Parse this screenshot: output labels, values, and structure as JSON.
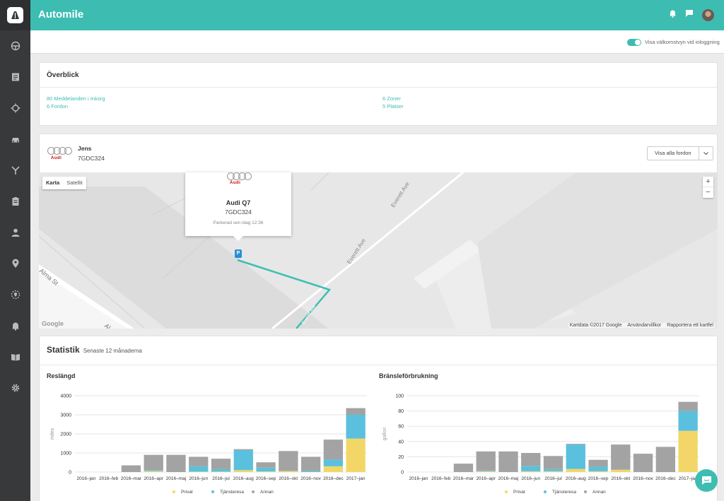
{
  "app": {
    "title": "Automile"
  },
  "sidebar": {
    "items": [
      {
        "name": "dashboard-icon"
      },
      {
        "name": "journal-icon"
      },
      {
        "name": "location-icon"
      },
      {
        "name": "car-icon"
      },
      {
        "name": "trips-icon"
      },
      {
        "name": "reports-icon"
      },
      {
        "name": "user-icon"
      },
      {
        "name": "places-icon"
      },
      {
        "name": "zones-icon"
      },
      {
        "name": "alerts-icon"
      },
      {
        "name": "book-icon"
      },
      {
        "name": "settings-icon"
      }
    ]
  },
  "subheader": {
    "toggle_label": "Visa välkomstvyn vid inloggning",
    "toggle_on": true
  },
  "overview": {
    "title": "Överblick",
    "links": {
      "inbox": "80 Meddelanden i Inkorg",
      "vehicles": "6 Fordon",
      "zones": "6 Zoner",
      "places": "5 Platser"
    }
  },
  "vehicle": {
    "driver": "Jens",
    "plate": "7GDC324",
    "brand_text": "Audi",
    "show_all_button": "Visa alla fordon"
  },
  "map": {
    "type_map": "Karta",
    "type_satellite": "Satellit",
    "zoom_in": "+",
    "zoom_out": "−",
    "attribution": "Kartdata ©2017 Google",
    "terms": "Användarvillkor",
    "report": "Rapportera ett kartfel",
    "google": "Google",
    "street_everett_1": "Everett Ave",
    "street_everett_2": "Everett Ave",
    "street_alma": "Alma St",
    "street_al": "Al",
    "street_small": "Everett Ave",
    "popup": {
      "brand_text": "Audi",
      "model": "Audi Q7",
      "plate": "7GDC324",
      "status": "Parkerad sen idag 12:36"
    },
    "pin_label": "P"
  },
  "stats": {
    "title": "Statistik",
    "subtitle": "Senaste 12 månaderna"
  },
  "colors": {
    "accent": "#3dbdb2",
    "privat": "#f2d768",
    "tjanst": "#5bc0de",
    "annan": "#a3a3a3"
  },
  "chart_data": [
    {
      "type": "bar",
      "stacked": true,
      "title": "Reslängd",
      "ylabel": "miles",
      "ylim": [
        0,
        4000
      ],
      "yticks": [
        0,
        1000,
        2000,
        3000,
        4000
      ],
      "categories": [
        "2016–jan",
        "2016–feb",
        "2016–mar",
        "2016–apr",
        "2016–maj",
        "2016–jun",
        "2016–jul",
        "2016–aug",
        "2016–sep",
        "2016–okt",
        "2016–nov",
        "2016–dec",
        "2017–jan"
      ],
      "series": [
        {
          "name": "Privat",
          "values": [
            0,
            0,
            0,
            50,
            0,
            20,
            20,
            100,
            30,
            50,
            0,
            300,
            1750
          ]
        },
        {
          "name": "Tjänsteresa",
          "values": [
            0,
            0,
            0,
            50,
            0,
            280,
            130,
            1050,
            200,
            0,
            50,
            350,
            1250
          ]
        },
        {
          "name": "Annan",
          "values": [
            0,
            0,
            350,
            800,
            900,
            500,
            550,
            50,
            280,
            1050,
            750,
            1050,
            350
          ]
        }
      ],
      "legend_position": "bottom"
    },
    {
      "type": "bar",
      "stacked": true,
      "title": "Bränsleförbrukning",
      "ylabel": "gallon",
      "ylim": [
        0,
        100
      ],
      "yticks": [
        0,
        20,
        40,
        60,
        80,
        100
      ],
      "categories": [
        "2016–jan",
        "2016–feb",
        "2016–mar",
        "2016–apr",
        "2016–maj",
        "2016–jun",
        "2016–jul",
        "2016–aug",
        "2016–sep",
        "2016–okt",
        "2016–nov",
        "2016–dec",
        "2017–jan"
      ],
      "series": [
        {
          "name": "Privat",
          "values": [
            0,
            0,
            0,
            1,
            0,
            1,
            1,
            4,
            1,
            3,
            0,
            0,
            54
          ]
        },
        {
          "name": "Tjänsteresa",
          "values": [
            0,
            0,
            0,
            1,
            0,
            7,
            3,
            32,
            6,
            0,
            0,
            0,
            26
          ]
        },
        {
          "name": "Annan",
          "values": [
            0,
            0,
            11,
            25,
            27,
            17,
            17,
            1,
            9,
            33,
            24,
            33,
            12
          ]
        }
      ],
      "legend_position": "bottom"
    }
  ]
}
